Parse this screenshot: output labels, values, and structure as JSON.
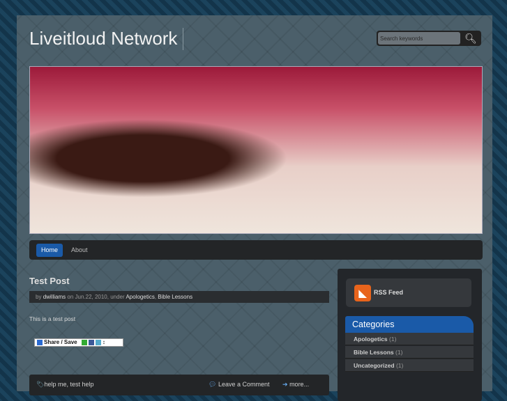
{
  "site": {
    "title": "Liveitloud Network"
  },
  "search": {
    "placeholder": "Search keywords"
  },
  "nav": {
    "items": [
      "Home",
      "About"
    ]
  },
  "post": {
    "title": "Test Post",
    "meta_by": "by",
    "author": "dwilliams",
    "meta_on": "on Jun.22, 2010, under",
    "categories": [
      "Apologetics",
      "Bible Lessons"
    ],
    "body": "This is a test post",
    "share_label": "Share / Save",
    "tags": "help me, test help",
    "comment_link": "Leave a Comment",
    "more_link": "more..."
  },
  "sidebar": {
    "rss_label": "RSS Feed",
    "categories_title": "Categories",
    "categories": [
      {
        "name": "Apologetics",
        "count": "(1)"
      },
      {
        "name": "Bible Lessons",
        "count": "(1)"
      },
      {
        "name": "Uncategorized",
        "count": "(1)"
      }
    ]
  }
}
